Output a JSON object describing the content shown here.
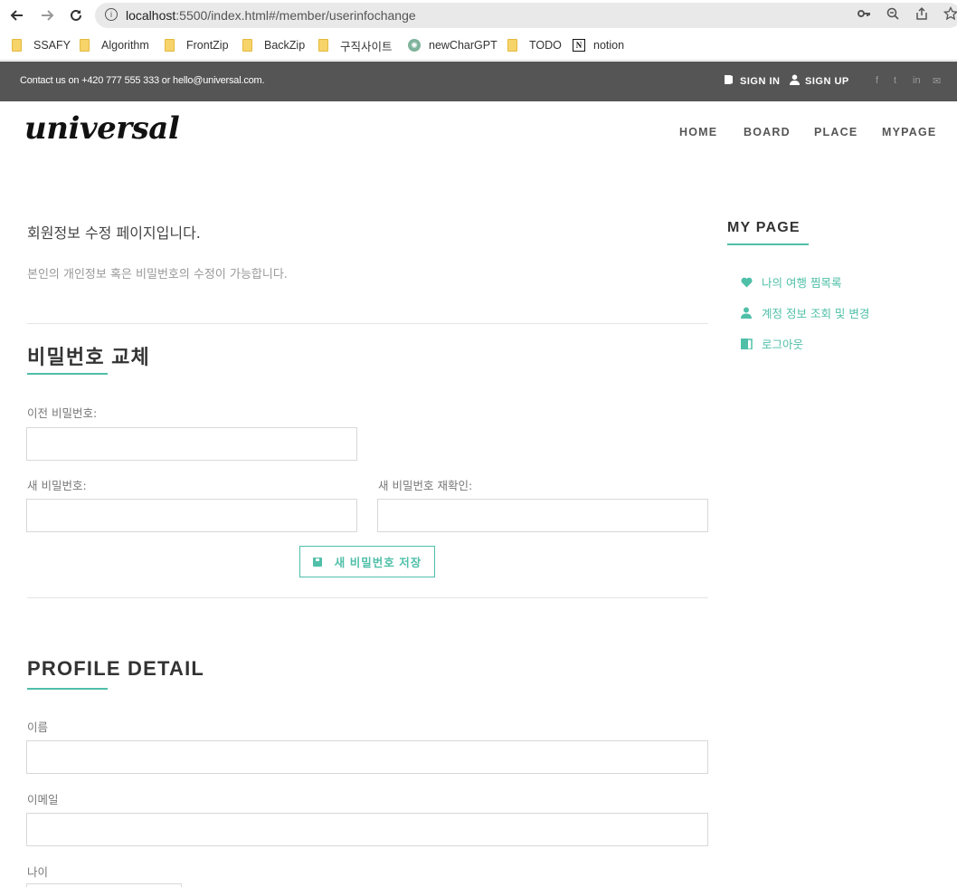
{
  "browser": {
    "url_host": "localhost",
    "url_rest": ":5500/index.html#/member/userinfochange",
    "bookmarks": [
      {
        "label": "SSAFY",
        "icon": "folder-icon"
      },
      {
        "label": "Algorithm",
        "icon": "folder-icon"
      },
      {
        "label": "FrontZip",
        "icon": "folder-icon"
      },
      {
        "label": "BackZip",
        "icon": "folder-icon"
      },
      {
        "label": "구직사이트",
        "icon": "folder-icon"
      },
      {
        "label": "newCharGPT",
        "icon": "chatgpt-icon"
      },
      {
        "label": "TODO",
        "icon": "folder-icon"
      },
      {
        "label": "notion",
        "icon": "notion-icon"
      }
    ]
  },
  "topbar": {
    "contact": "Contact us on +420 777 555 333 or hello@universal.com.",
    "sign_in": "SIGN IN",
    "sign_up": "SIGN UP",
    "social": [
      "f",
      "t",
      "in",
      "✉"
    ]
  },
  "header": {
    "logo": "universal",
    "nav": [
      "HOME",
      "BOARD",
      "PLACE",
      "MYPAGE"
    ]
  },
  "main": {
    "intro_title": "회원정보 수정 페이지입니다.",
    "intro_sub": "본인의 개인정보 혹은 비밀번호의 수정이 가능합니다.",
    "password_section": {
      "title": "비밀번호 교체",
      "old_label": "이전 비밀번호:",
      "new_label": "새 비밀번호:",
      "confirm_label": "새 비밀번호 재확인:",
      "save_button": "새 비밀번호 저장"
    },
    "profile_section": {
      "title": "PROFILE DETAIL",
      "name_label": "이름",
      "email_label": "이메일",
      "age_label": "나이"
    }
  },
  "sidebar": {
    "title": "MY PAGE",
    "items": [
      {
        "label": "나의 여행 찜목록",
        "icon": "heart-icon"
      },
      {
        "label": "계정 정보 조회 및 변경",
        "icon": "user-icon"
      },
      {
        "label": "로그아웃",
        "icon": "door-icon"
      }
    ]
  },
  "colors": {
    "accent": "#4fbfa8",
    "topbar": "#555555"
  }
}
